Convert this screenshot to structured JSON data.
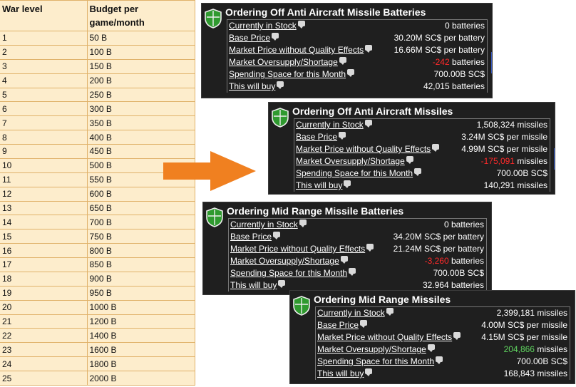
{
  "table": {
    "col1": "War level",
    "col2": "Budget per game/month",
    "rows": [
      [
        "1",
        "50 B"
      ],
      [
        "2",
        "100 B"
      ],
      [
        "3",
        "150 B"
      ],
      [
        "4",
        "200 B"
      ],
      [
        "5",
        "250 B"
      ],
      [
        "6",
        "300 B"
      ],
      [
        "7",
        "350 B"
      ],
      [
        "8",
        "400 B"
      ],
      [
        "9",
        "450 B"
      ],
      [
        "10",
        "500 B"
      ],
      [
        "11",
        "550 B"
      ],
      [
        "12",
        "600 B"
      ],
      [
        "13",
        "650 B"
      ],
      [
        "14",
        "700 B"
      ],
      [
        "15",
        "750 B"
      ],
      [
        "16",
        "800 B"
      ],
      [
        "17",
        "850 B"
      ],
      [
        "18",
        "900 B"
      ],
      [
        "19",
        "950 B"
      ],
      [
        "20",
        "1000 B"
      ],
      [
        "21",
        "1200 B"
      ],
      [
        "22",
        "1400 B"
      ],
      [
        "23",
        "1600 B"
      ],
      [
        "24",
        "1800 B"
      ],
      [
        "25",
        "2000 B"
      ]
    ]
  },
  "arrow_color": "#f08020",
  "colors": {
    "panel_bg": "#1f1f1f",
    "negative": "#ff2a2a",
    "positive": "#5fd35f",
    "shield": "#2f9a2f"
  },
  "panels": [
    {
      "title": "Ordering Off Anti Aircraft Missile Batteries",
      "rows": [
        {
          "label": "Currently in Stock",
          "value": "0 batteries"
        },
        {
          "label": "Base Price",
          "value": "30.20M SC$ per battery"
        },
        {
          "label": "Market Price without Quality Effects",
          "value": "16.66M SC$ per battery"
        },
        {
          "label": "Market Oversupply/Shortage",
          "value_num": "-242",
          "value_unit": "batteries"
        },
        {
          "label": "Spending Space for this Month",
          "value": "700.00B SC$"
        },
        {
          "label": "This will buy",
          "value": "42,015 batteries"
        }
      ]
    },
    {
      "title": "Ordering Off Anti Aircraft Missiles",
      "rows": [
        {
          "label": "Currently in Stock",
          "value": "1,508,324 missiles"
        },
        {
          "label": "Base Price",
          "value": "3.24M SC$ per missile"
        },
        {
          "label": "Market Price without Quality Effects",
          "value": "4.99M SC$ per missile"
        },
        {
          "label": "Market Oversupply/Shortage",
          "value_num": "-175,091",
          "value_unit": "missiles"
        },
        {
          "label": "Spending Space for this Month",
          "value": "700.00B SC$"
        },
        {
          "label": "This will buy",
          "value": "140,291 missiles"
        }
      ]
    },
    {
      "title": "Ordering Mid Range Missile Batteries",
      "rows": [
        {
          "label": "Currently in Stock",
          "value": "0 batteries"
        },
        {
          "label": "Base Price",
          "value": "34.20M SC$ per battery"
        },
        {
          "label": "Market Price without Quality Effects",
          "value": "21.24M SC$ per battery"
        },
        {
          "label": "Market Oversupply/Shortage",
          "value_num": "-3,260",
          "value_unit": "batteries"
        },
        {
          "label": "Spending Space for this Month",
          "value": "700.00B SC$"
        },
        {
          "label": "This will buy",
          "value": "32.964 batteries"
        }
      ]
    },
    {
      "title": "Ordering Mid Range Missiles",
      "rows": [
        {
          "label": "Currently in Stock",
          "value": "2,399,181 missiles"
        },
        {
          "label": "Base Price",
          "value": "4.00M SC$ per missile"
        },
        {
          "label": "Market Price without Quality Effects",
          "value": "4.15M SC$ per missile"
        },
        {
          "label": "Market Oversupply/Shortage",
          "value_num": "204,866",
          "value_unit": "missiles"
        },
        {
          "label": "Spending Space for this Month",
          "value": "700.00B SC$"
        },
        {
          "label": "This will buy",
          "value": "168,843 missiles"
        }
      ]
    }
  ]
}
